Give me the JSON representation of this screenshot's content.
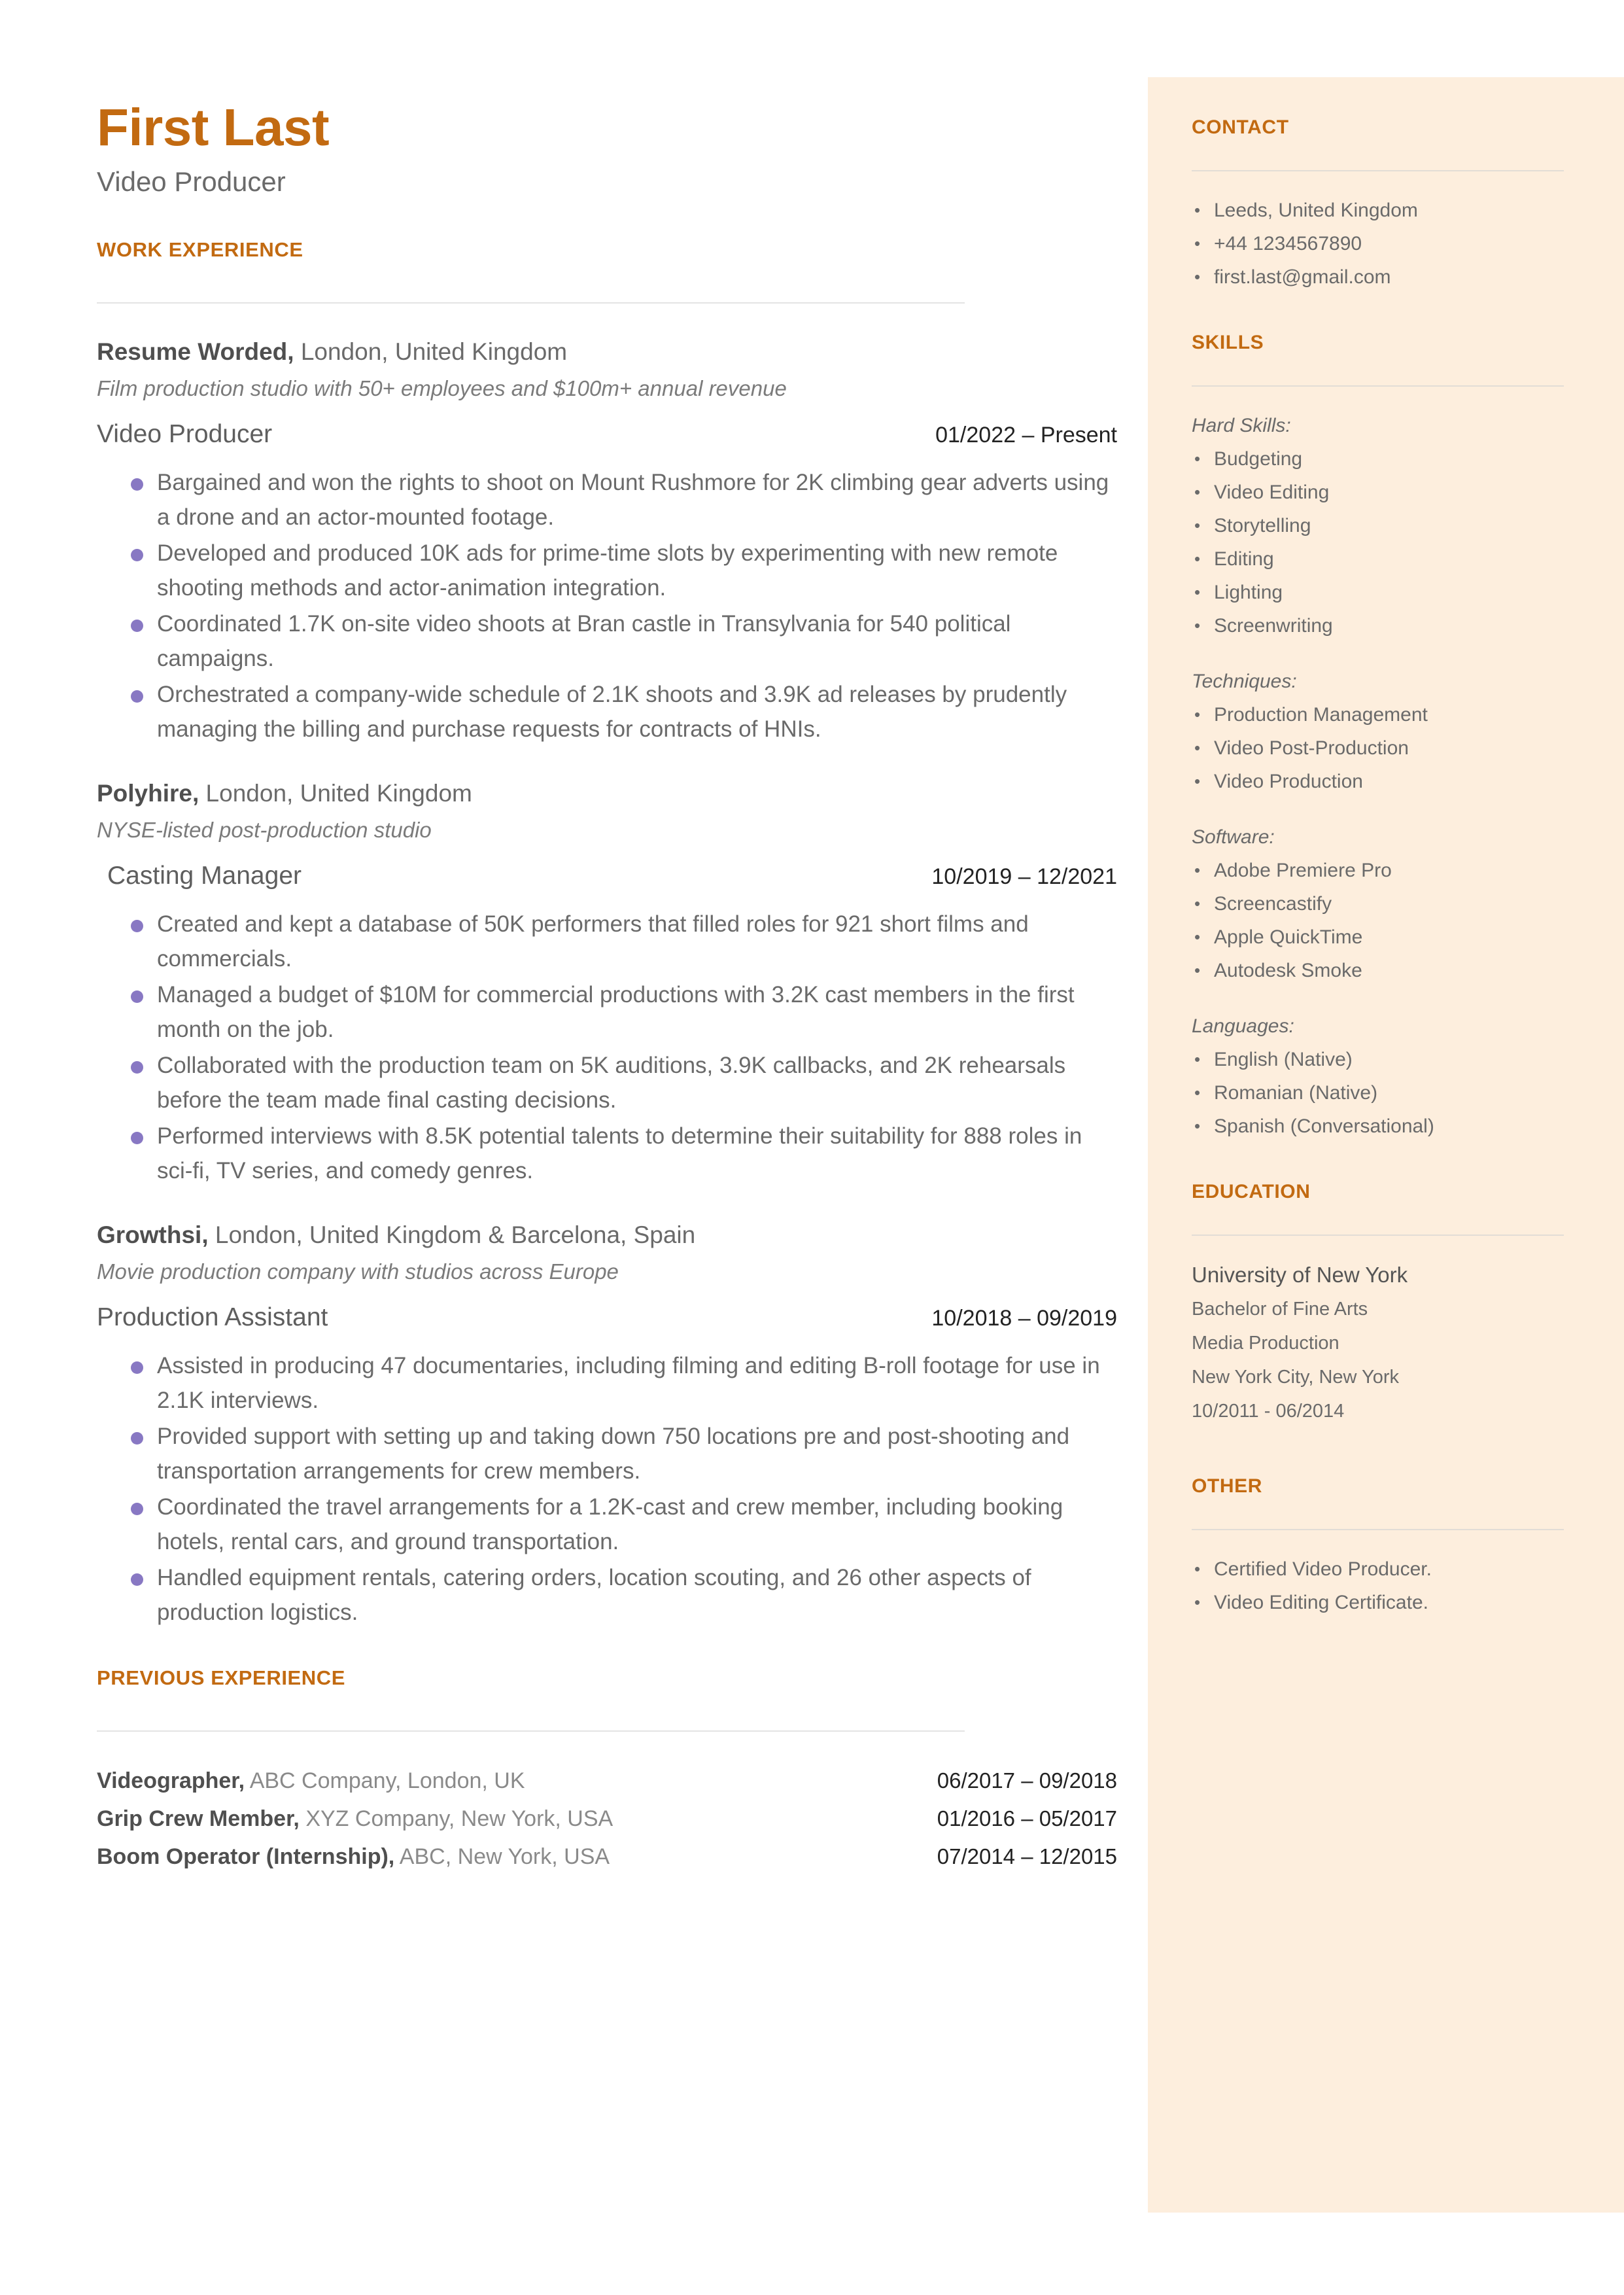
{
  "theme": {
    "accent": "#c26a11",
    "sidebar_bg": "#fdeedd",
    "bullet": "#8878c3",
    "body_text": "#6a6a6a"
  },
  "header": {
    "name": "First Last",
    "title": "Video Producer"
  },
  "sections": {
    "work_experience_heading": "WORK EXPERIENCE",
    "previous_experience_heading": "PREVIOUS EXPERIENCE"
  },
  "jobs": [
    {
      "company": "Resume Worded,",
      "location": " London, United Kingdom",
      "description": "Film production studio with 50+ employees and $100m+ annual revenue",
      "role": "Video Producer",
      "date": "01/2022 – Present",
      "bullets": [
        "Bargained and won the rights to shoot on Mount Rushmore for 2K climbing gear adverts using a drone and an actor-mounted footage.",
        "Developed and produced 10K ads for prime-time slots by experimenting with new remote shooting methods and actor-animation integration.",
        "Coordinated 1.7K on-site video shoots at Bran castle in Transylvania for 540 political campaigns.",
        "Orchestrated a company-wide schedule of 2.1K shoots and 3.9K ad releases by prudently managing the billing and purchase requests for contracts of HNIs."
      ]
    },
    {
      "company": "Polyhire,",
      "location": " London, United Kingdom",
      "description": "NYSE-listed post-production studio",
      "role": "Casting Manager",
      "date": "10/2019 – 12/2021",
      "bullets": [
        "Created and kept a database of 50K performers that filled roles for 921 short films and commercials.",
        "Managed a budget of $10M for commercial productions with 3.2K cast members in the first month on the job.",
        "Collaborated with the production team on 5K auditions, 3.9K callbacks, and 2K rehearsals before the team made final casting decisions.",
        "Performed interviews with 8.5K potential talents to determine their suitability for 888 roles in sci-fi, TV series, and comedy genres."
      ]
    },
    {
      "company": "Growthsi,",
      "location": " London, United Kingdom & Barcelona, Spain",
      "description": "Movie production company with studios across Europe",
      "role": "Production Assistant",
      "date": "10/2018 – 09/2019",
      "bullets": [
        "Assisted in producing 47 documentaries, including filming and editing B-roll footage for use in 2.1K interviews.",
        "Provided support with setting up and taking down 750 locations pre and post-shooting and transportation arrangements for crew members.",
        "Coordinated the travel arrangements for a 1.2K-cast and crew member, including booking hotels, rental cars, and ground transportation.",
        "Handled equipment rentals, catering orders, location scouting, and 26 other aspects of production logistics."
      ]
    }
  ],
  "previous_experience": [
    {
      "title": "Videographer,",
      "detail": " ABC Company, London, UK",
      "date": "06/2017 – 09/2018"
    },
    {
      "title": "Grip Crew Member,",
      "detail": " XYZ Company, New York, USA",
      "date": "01/2016 – 05/2017"
    },
    {
      "title": "Boom Operator (Internship),",
      "detail": " ABC, New York, USA",
      "date": "07/2014 – 12/2015"
    }
  ],
  "sidebar": {
    "contact": {
      "heading": "CONTACT",
      "items": [
        "Leeds, United Kingdom",
        "+44 1234567890",
        "first.last@gmail.com"
      ]
    },
    "skills": {
      "heading": "SKILLS",
      "groups": [
        {
          "label": "Hard Skills:",
          "items": [
            "Budgeting",
            "Video Editing",
            "Storytelling",
            "Editing",
            "Lighting",
            "Screenwriting"
          ]
        },
        {
          "label": "Techniques:",
          "items": [
            "Production Management",
            "Video Post-Production",
            "Video Production"
          ]
        },
        {
          "label": "Software:",
          "items": [
            "Adobe Premiere Pro",
            "Screencastify",
            "Apple QuickTime",
            "Autodesk Smoke"
          ]
        },
        {
          "label": "Languages:",
          "items": [
            "English (Native)",
            "Romanian (Native)",
            "Spanish (Conversational)"
          ]
        }
      ]
    },
    "education": {
      "heading": "EDUCATION",
      "school": "University of New York",
      "degree": "Bachelor of Fine Arts",
      "field": "Media Production",
      "location": "New York City, New York",
      "dates": "10/2011 - 06/2014"
    },
    "other": {
      "heading": "OTHER",
      "items": [
        "Certified Video Producer.",
        "Video Editing Certificate."
      ]
    }
  }
}
